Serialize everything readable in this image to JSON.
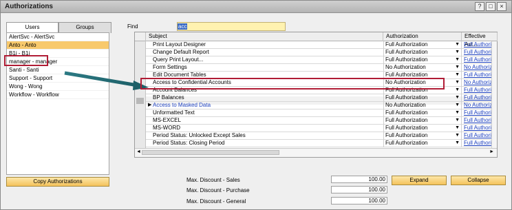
{
  "window": {
    "title": "Authorizations"
  },
  "tabs": {
    "users": "Users",
    "groups": "Groups"
  },
  "users": [
    "AlertSvc - AlertSvc",
    "Anto - Anto",
    "B1i - B1i",
    "manager - manager",
    "Santi - Santi",
    "Support - Support",
    "Wong - Wong",
    "Workflow - Workflow"
  ],
  "selected_user": "Anto - Anto",
  "copy_button": "Copy Authorizations",
  "find": {
    "label": "Find",
    "value": "acc"
  },
  "grid": {
    "columns": {
      "subject": "Subject",
      "authorization": "Authorization",
      "effective": "Effective Aut..."
    },
    "rows": [
      {
        "subject": "Print Layout Designer",
        "auth": "Full Authorization",
        "eff": "Full Authorization"
      },
      {
        "subject": "Change Default Report",
        "auth": "Full Authorization",
        "eff": "Full Authorization"
      },
      {
        "subject": "Query Print Layout...",
        "auth": "Full Authorization",
        "eff": "Full Authorization"
      },
      {
        "subject": "Form Settings",
        "auth": "No Authorization",
        "eff": "No Authorization"
      },
      {
        "subject": "Edit Document Tables",
        "auth": "Full Authorization",
        "eff": "Full Authorization"
      },
      {
        "subject": "Access to Confidential Accounts",
        "auth": "No Authorization",
        "eff": "No Authorization"
      },
      {
        "subject": "Account Balances",
        "auth": "Full Authorization",
        "eff": "Full Authorization"
      },
      {
        "subject": "BP Balances",
        "auth": "Full Authorization",
        "eff": "Full Authorization"
      },
      {
        "subject": "Access to Masked Data",
        "auth": "No Authorization",
        "eff": "No Authorization"
      },
      {
        "subject": "Unformatted Text",
        "auth": "Full Authorization",
        "eff": "Full Authorization"
      },
      {
        "subject": "MS-EXCEL",
        "auth": "Full Authorization",
        "eff": "Full Authorization"
      },
      {
        "subject": "MS-WORD",
        "auth": "Full Authorization",
        "eff": "Full Authorization"
      },
      {
        "subject": "Period Status: Unlocked Except Sales",
        "auth": "Full Authorization",
        "eff": "Full Authorization"
      },
      {
        "subject": "Period Status: Closing Period",
        "auth": "Full Authorization",
        "eff": "Full Authorization"
      }
    ]
  },
  "discounts": {
    "sales_label": "Max. Discount - Sales",
    "sales_value": "100.00",
    "purchase_label": "Max. Discount - Purchase",
    "purchase_value": "100.00",
    "general_label": "Max. Discount - General",
    "general_value": "100.00"
  },
  "buttons": {
    "expand": "Expand",
    "collapse": "Collapse"
  },
  "colors": {
    "selected": "#f8c96c",
    "highlight": "#b01c35",
    "link": "#1b3fbe"
  }
}
